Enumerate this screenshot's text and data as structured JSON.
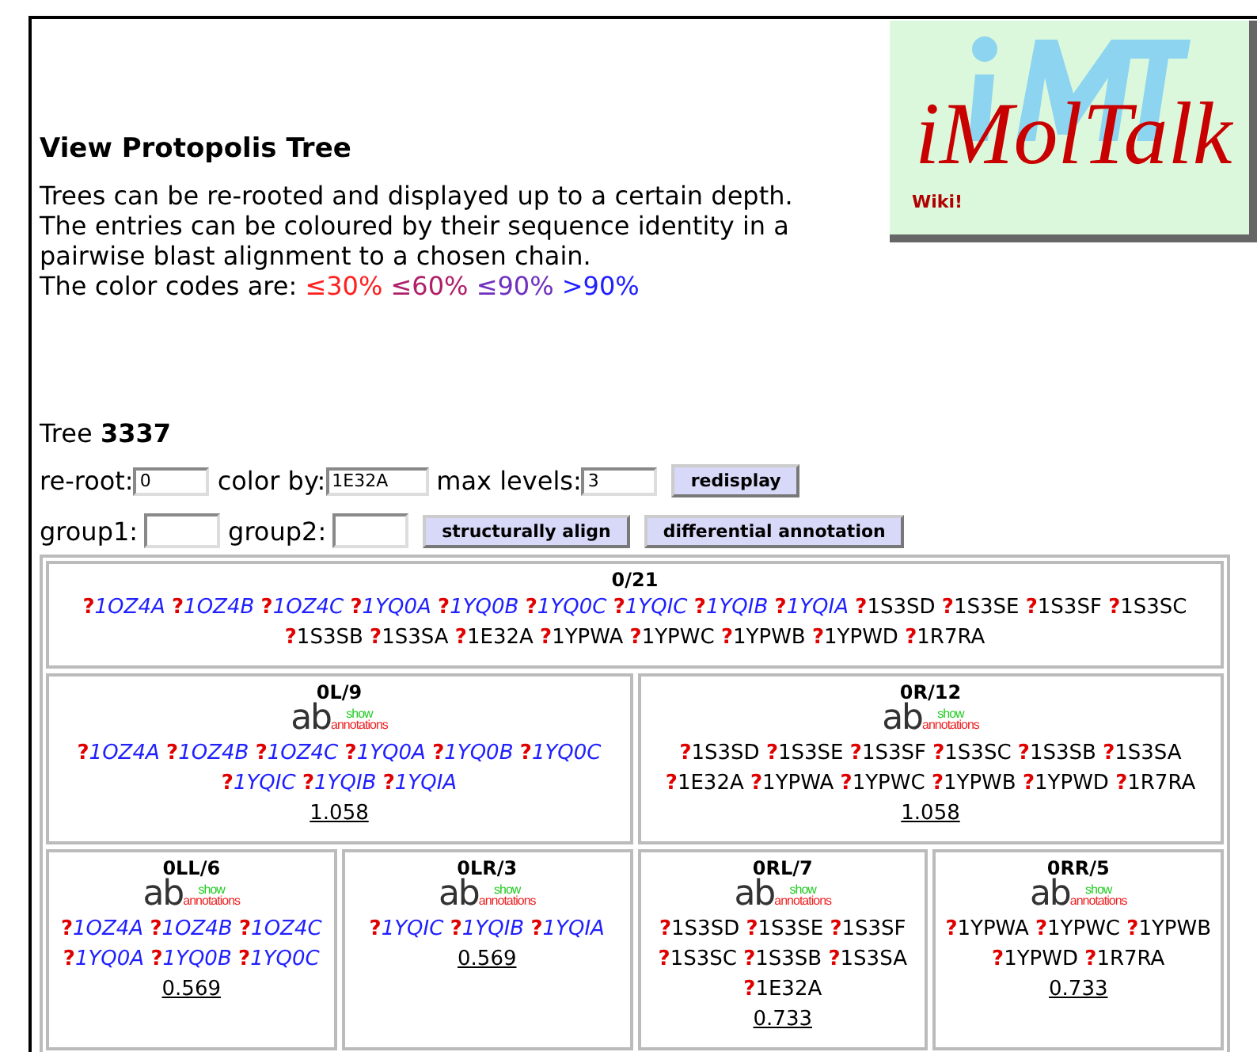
{
  "logo": {
    "title": "iMolTalk",
    "link": "Wiki!"
  },
  "heading": "View Protopolis Tree",
  "description": [
    "Trees can be re-rooted and displayed up to a certain depth.",
    "The entries can be coloured by their sequence identity in a",
    "pairwise blast alignment to a chosen chain."
  ],
  "color_codes": {
    "label": "The color codes are:",
    "items": [
      {
        "text": "≤30%",
        "color": "#ff2020"
      },
      {
        "text": "≤60%",
        "color": "#b0206a"
      },
      {
        "text": "≤90%",
        "color": "#7030c0"
      },
      {
        "text": ">90%",
        "color": "#2020ff"
      }
    ]
  },
  "tree": {
    "label": "Tree",
    "id": "3337"
  },
  "form": {
    "fields": [
      {
        "label": "re-root:",
        "value": "0"
      },
      {
        "label": "color by:",
        "value": "1E32A"
      },
      {
        "label": "max levels:",
        "value": "3"
      }
    ],
    "button": "redisplay"
  },
  "groups": {
    "fields": [
      {
        "label": "group1:"
      },
      {
        "label": "group2:"
      }
    ],
    "buttons": [
      "structurally align",
      "differential annotation"
    ]
  },
  "root": {
    "title": "0/21",
    "entries": [
      {
        "mark": "?",
        "id": "1OZ4A",
        "kind": "hit",
        "color": "#2020ff"
      },
      {
        "mark": "?",
        "id": "1OZ4B",
        "kind": "hit",
        "color": "#2020ff"
      },
      {
        "mark": "?",
        "id": "1OZ4C",
        "kind": "hit",
        "color": "#2020ff"
      },
      {
        "mark": "?",
        "id": "1YQ0A",
        "kind": "hit",
        "color": "#2020ff"
      },
      {
        "mark": "?",
        "id": "1YQ0B",
        "kind": "hit",
        "color": "#2020ff"
      },
      {
        "mark": "?",
        "id": "1YQ0C",
        "kind": "hit",
        "color": "#2020ff"
      },
      {
        "mark": "?",
        "id": "1YQIC",
        "kind": "hit",
        "color": "#2020ff"
      },
      {
        "mark": "?",
        "id": "1YQIB",
        "kind": "hit",
        "color": "#2020ff"
      },
      {
        "mark": "?",
        "id": "1YQIA",
        "kind": "hit",
        "color": "#2020ff"
      },
      {
        "mark": "?",
        "id": "1S3SD",
        "kind": "plain",
        "color": "#000000"
      },
      {
        "mark": "?",
        "id": "1S3SE",
        "kind": "plain",
        "color": "#000000"
      },
      {
        "mark": "?",
        "id": "1S3SF",
        "kind": "plain",
        "color": "#000000"
      },
      {
        "mark": "?",
        "id": "1S3SC",
        "kind": "plain",
        "color": "#000000"
      },
      {
        "mark": "?",
        "id": "1S3SB",
        "kind": "plain",
        "color": "#000000"
      },
      {
        "mark": "?",
        "id": "1S3SA",
        "kind": "plain",
        "color": "#000000"
      },
      {
        "mark": "?",
        "id": "1E32A",
        "kind": "plain",
        "color": "#000000"
      },
      {
        "mark": "?",
        "id": "1YPWA",
        "kind": "plain",
        "color": "#000000"
      },
      {
        "mark": "?",
        "id": "1YPWC",
        "kind": "plain",
        "color": "#000000"
      },
      {
        "mark": "?",
        "id": "1YPWB",
        "kind": "plain",
        "color": "#000000"
      },
      {
        "mark": "?",
        "id": "1YPWD",
        "kind": "plain",
        "color": "#000000"
      },
      {
        "mark": "?",
        "id": "1R7RA",
        "kind": "plain",
        "color": "#000000"
      }
    ],
    "children": [
      {
        "title": "0L/9",
        "annotations": {
          "main": "ab",
          "top": "show",
          "bottom": "annotations"
        },
        "distance": "1.058",
        "entries": [
          {
            "mark": "?",
            "id": "1OZ4A",
            "kind": "hit",
            "color": "#2020ff"
          },
          {
            "mark": "?",
            "id": "1OZ4B",
            "kind": "hit",
            "color": "#2020ff"
          },
          {
            "mark": "?",
            "id": "1OZ4C",
            "kind": "hit",
            "color": "#2020ff"
          },
          {
            "mark": "?",
            "id": "1YQ0A",
            "kind": "hit",
            "color": "#2020ff"
          },
          {
            "mark": "?",
            "id": "1YQ0B",
            "kind": "hit",
            "color": "#2020ff"
          },
          {
            "mark": "?",
            "id": "1YQ0C",
            "kind": "hit",
            "color": "#2020ff"
          },
          {
            "mark": "?",
            "id": "1YQIC",
            "kind": "hit",
            "color": "#2020ff"
          },
          {
            "mark": "?",
            "id": "1YQIB",
            "kind": "hit",
            "color": "#2020ff"
          },
          {
            "mark": "?",
            "id": "1YQIA",
            "kind": "hit",
            "color": "#2020ff"
          }
        ],
        "children": [
          {
            "title": "0LL/6",
            "annotations": {
              "main": "ab",
              "top": "show",
              "bottom": "annotations"
            },
            "distance": "0.569",
            "entries": [
              {
                "mark": "?",
                "id": "1OZ4A",
                "kind": "hit",
                "color": "#2020ff"
              },
              {
                "mark": "?",
                "id": "1OZ4B",
                "kind": "hit",
                "color": "#2020ff"
              },
              {
                "mark": "?",
                "id": "1OZ4C",
                "kind": "hit",
                "color": "#2020ff"
              },
              {
                "mark": "?",
                "id": "1YQ0A",
                "kind": "hit",
                "color": "#2020ff"
              },
              {
                "mark": "?",
                "id": "1YQ0B",
                "kind": "hit",
                "color": "#2020ff"
              },
              {
                "mark": "?",
                "id": "1YQ0C",
                "kind": "hit",
                "color": "#2020ff"
              }
            ]
          },
          {
            "title": "0LR/3",
            "annotations": {
              "main": "ab",
              "top": "show",
              "bottom": "annotations"
            },
            "distance": "0.569",
            "entries": [
              {
                "mark": "?",
                "id": "1YQIC",
                "kind": "hit",
                "color": "#2020ff"
              },
              {
                "mark": "?",
                "id": "1YQIB",
                "kind": "hit",
                "color": "#2020ff"
              },
              {
                "mark": "?",
                "id": "1YQIA",
                "kind": "hit",
                "color": "#2020ff"
              }
            ]
          }
        ]
      },
      {
        "title": "0R/12",
        "annotations": {
          "main": "ab",
          "top": "show",
          "bottom": "annotations"
        },
        "distance": "1.058",
        "entries": [
          {
            "mark": "?",
            "id": "1S3SD",
            "kind": "plain",
            "color": "#000000"
          },
          {
            "mark": "?",
            "id": "1S3SE",
            "kind": "plain",
            "color": "#000000"
          },
          {
            "mark": "?",
            "id": "1S3SF",
            "kind": "plain",
            "color": "#000000"
          },
          {
            "mark": "?",
            "id": "1S3SC",
            "kind": "plain",
            "color": "#000000"
          },
          {
            "mark": "?",
            "id": "1S3SB",
            "kind": "plain",
            "color": "#000000"
          },
          {
            "mark": "?",
            "id": "1S3SA",
            "kind": "plain",
            "color": "#000000"
          },
          {
            "mark": "?",
            "id": "1E32A",
            "kind": "plain",
            "color": "#000000"
          },
          {
            "mark": "?",
            "id": "1YPWA",
            "kind": "plain",
            "color": "#000000"
          },
          {
            "mark": "?",
            "id": "1YPWC",
            "kind": "plain",
            "color": "#000000"
          },
          {
            "mark": "?",
            "id": "1YPWB",
            "kind": "plain",
            "color": "#000000"
          },
          {
            "mark": "?",
            "id": "1YPWD",
            "kind": "plain",
            "color": "#000000"
          },
          {
            "mark": "?",
            "id": "1R7RA",
            "kind": "plain",
            "color": "#000000"
          }
        ],
        "children": [
          {
            "title": "0RL/7",
            "annotations": {
              "main": "ab",
              "top": "show",
              "bottom": "annotations"
            },
            "distance": "0.733",
            "entries": [
              {
                "mark": "?",
                "id": "1S3SD",
                "kind": "plain",
                "color": "#000000"
              },
              {
                "mark": "?",
                "id": "1S3SE",
                "kind": "plain",
                "color": "#000000"
              },
              {
                "mark": "?",
                "id": "1S3SF",
                "kind": "plain",
                "color": "#000000"
              },
              {
                "mark": "?",
                "id": "1S3SC",
                "kind": "plain",
                "color": "#000000"
              },
              {
                "mark": "?",
                "id": "1S3SB",
                "kind": "plain",
                "color": "#000000"
              },
              {
                "mark": "?",
                "id": "1S3SA",
                "kind": "plain",
                "color": "#000000"
              },
              {
                "mark": "?",
                "id": "1E32A",
                "kind": "plain",
                "color": "#000000"
              }
            ]
          },
          {
            "title": "0RR/5",
            "annotations": {
              "main": "ab",
              "top": "show",
              "bottom": "annotations"
            },
            "distance": "0.733",
            "entries": [
              {
                "mark": "?",
                "id": "1YPWA",
                "kind": "plain",
                "color": "#000000"
              },
              {
                "mark": "?",
                "id": "1YPWC",
                "kind": "plain",
                "color": "#000000"
              },
              {
                "mark": "?",
                "id": "1YPWB",
                "kind": "plain",
                "color": "#000000"
              },
              {
                "mark": "?",
                "id": "1YPWD",
                "kind": "plain",
                "color": "#000000"
              },
              {
                "mark": "?",
                "id": "1R7RA",
                "kind": "plain",
                "color": "#000000"
              }
            ]
          }
        ]
      }
    ]
  }
}
